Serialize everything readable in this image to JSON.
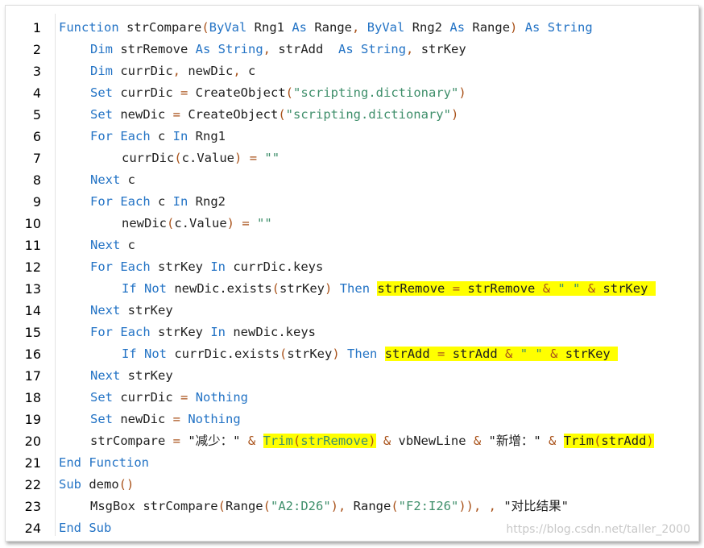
{
  "colors": {
    "keyword": "#2373c5",
    "string": "#3f8f6b",
    "operator": "#a9521a",
    "plain": "#1f1f1f",
    "highlight": "#ffff00"
  },
  "lines": [
    {
      "num": "1",
      "indent": 0,
      "tokens": [
        {
          "t": "Function",
          "c": "kw"
        },
        {
          "t": " strCompare"
        },
        {
          "t": "(",
          "c": "op"
        },
        {
          "t": "ByVal",
          "c": "kw"
        },
        {
          "t": " Rng1 "
        },
        {
          "t": "As",
          "c": "kw"
        },
        {
          "t": " Range"
        },
        {
          "t": ",",
          "c": "op"
        },
        {
          "t": " "
        },
        {
          "t": "ByVal",
          "c": "kw"
        },
        {
          "t": " Rng2 "
        },
        {
          "t": "As",
          "c": "kw"
        },
        {
          "t": " Range"
        },
        {
          "t": ")",
          "c": "op"
        },
        {
          "t": " "
        },
        {
          "t": "As",
          "c": "kw"
        },
        {
          "t": " "
        },
        {
          "t": "String",
          "c": "kw"
        }
      ]
    },
    {
      "num": "2",
      "indent": 1,
      "tokens": [
        {
          "t": "Dim",
          "c": "kw"
        },
        {
          "t": " strRemove "
        },
        {
          "t": "As",
          "c": "kw"
        },
        {
          "t": " "
        },
        {
          "t": "String",
          "c": "kw"
        },
        {
          "t": ",",
          "c": "op"
        },
        {
          "t": " strAdd  "
        },
        {
          "t": "As",
          "c": "kw"
        },
        {
          "t": " "
        },
        {
          "t": "String",
          "c": "kw"
        },
        {
          "t": ",",
          "c": "op"
        },
        {
          "t": " strKey"
        }
      ]
    },
    {
      "num": "3",
      "indent": 1,
      "tokens": [
        {
          "t": "Dim",
          "c": "kw"
        },
        {
          "t": " currDic"
        },
        {
          "t": ",",
          "c": "op"
        },
        {
          "t": " newDic"
        },
        {
          "t": ",",
          "c": "op"
        },
        {
          "t": " c"
        }
      ]
    },
    {
      "num": "4",
      "indent": 1,
      "tokens": [
        {
          "t": "Set",
          "c": "kw"
        },
        {
          "t": " currDic "
        },
        {
          "t": "=",
          "c": "op"
        },
        {
          "t": " CreateObject"
        },
        {
          "t": "(",
          "c": "op"
        },
        {
          "t": "\"scripting.dictionary\"",
          "c": "str"
        },
        {
          "t": ")",
          "c": "op"
        }
      ]
    },
    {
      "num": "5",
      "indent": 1,
      "tokens": [
        {
          "t": "Set",
          "c": "kw"
        },
        {
          "t": " newDic "
        },
        {
          "t": "=",
          "c": "op"
        },
        {
          "t": " CreateObject"
        },
        {
          "t": "(",
          "c": "op"
        },
        {
          "t": "\"scripting.dictionary\"",
          "c": "str"
        },
        {
          "t": ")",
          "c": "op"
        }
      ]
    },
    {
      "num": "6",
      "indent": 1,
      "tokens": [
        {
          "t": "For",
          "c": "kw"
        },
        {
          "t": " "
        },
        {
          "t": "Each",
          "c": "kw"
        },
        {
          "t": " c "
        },
        {
          "t": "In",
          "c": "kw"
        },
        {
          "t": " Rng1"
        }
      ]
    },
    {
      "num": "7",
      "indent": 2,
      "tokens": [
        {
          "t": "currDic"
        },
        {
          "t": "(",
          "c": "op"
        },
        {
          "t": "c.Value"
        },
        {
          "t": ")",
          "c": "op"
        },
        {
          "t": " "
        },
        {
          "t": "=",
          "c": "op"
        },
        {
          "t": " "
        },
        {
          "t": "\"\"",
          "c": "str"
        }
      ]
    },
    {
      "num": "8",
      "indent": 1,
      "tokens": [
        {
          "t": "Next",
          "c": "kw"
        },
        {
          "t": " c"
        }
      ]
    },
    {
      "num": "9",
      "indent": 1,
      "tokens": [
        {
          "t": "For",
          "c": "kw"
        },
        {
          "t": " "
        },
        {
          "t": "Each",
          "c": "kw"
        },
        {
          "t": " c "
        },
        {
          "t": "In",
          "c": "kw"
        },
        {
          "t": " Rng2"
        }
      ]
    },
    {
      "num": "10",
      "indent": 2,
      "tokens": [
        {
          "t": "newDic"
        },
        {
          "t": "(",
          "c": "op"
        },
        {
          "t": "c.Value"
        },
        {
          "t": ")",
          "c": "op"
        },
        {
          "t": " "
        },
        {
          "t": "=",
          "c": "op"
        },
        {
          "t": " "
        },
        {
          "t": "\"\"",
          "c": "str"
        }
      ]
    },
    {
      "num": "11",
      "indent": 1,
      "tokens": [
        {
          "t": "Next",
          "c": "kw"
        },
        {
          "t": " c"
        }
      ]
    },
    {
      "num": "12",
      "indent": 1,
      "tokens": [
        {
          "t": "For",
          "c": "kw"
        },
        {
          "t": " "
        },
        {
          "t": "Each",
          "c": "kw"
        },
        {
          "t": " strKey "
        },
        {
          "t": "In",
          "c": "kw"
        },
        {
          "t": " currDic.keys"
        }
      ]
    },
    {
      "num": "13",
      "indent": 2,
      "tokens": [
        {
          "t": "If",
          "c": "kw"
        },
        {
          "t": " "
        },
        {
          "t": "Not",
          "c": "kw"
        },
        {
          "t": " newDic.exists"
        },
        {
          "t": "(",
          "c": "op"
        },
        {
          "t": "strKey"
        },
        {
          "t": ")",
          "c": "op"
        },
        {
          "t": " "
        },
        {
          "t": "Then",
          "c": "kw"
        },
        {
          "t": " "
        },
        {
          "t": "strRemove ",
          "h": true
        },
        {
          "t": "=",
          "c": "op",
          "h": true
        },
        {
          "t": " strRemove ",
          "h": true
        },
        {
          "t": "&",
          "c": "op",
          "h": true
        },
        {
          "t": " ",
          "h": true
        },
        {
          "t": "\" \"",
          "c": "str",
          "h": true
        },
        {
          "t": " ",
          "h": true
        },
        {
          "t": "&",
          "c": "op",
          "h": true
        },
        {
          "t": " strKey ",
          "h": true
        }
      ]
    },
    {
      "num": "14",
      "indent": 1,
      "tokens": [
        {
          "t": "Next",
          "c": "kw"
        },
        {
          "t": " strKey"
        }
      ]
    },
    {
      "num": "15",
      "indent": 1,
      "tokens": [
        {
          "t": "For",
          "c": "kw"
        },
        {
          "t": " "
        },
        {
          "t": "Each",
          "c": "kw"
        },
        {
          "t": " strKey "
        },
        {
          "t": "In",
          "c": "kw"
        },
        {
          "t": " newDic.keys"
        }
      ]
    },
    {
      "num": "16",
      "indent": 2,
      "tokens": [
        {
          "t": "If",
          "c": "kw"
        },
        {
          "t": " "
        },
        {
          "t": "Not",
          "c": "kw"
        },
        {
          "t": " currDic.exists"
        },
        {
          "t": "(",
          "c": "op"
        },
        {
          "t": "strKey"
        },
        {
          "t": ")",
          "c": "op"
        },
        {
          "t": " "
        },
        {
          "t": "Then",
          "c": "kw"
        },
        {
          "t": " "
        },
        {
          "t": "strAdd ",
          "h": true
        },
        {
          "t": "=",
          "c": "op",
          "h": true
        },
        {
          "t": " strAdd ",
          "h": true
        },
        {
          "t": "&",
          "c": "op",
          "h": true
        },
        {
          "t": " ",
          "h": true
        },
        {
          "t": "\" \"",
          "c": "str",
          "h": true
        },
        {
          "t": " ",
          "h": true
        },
        {
          "t": "&",
          "c": "op",
          "h": true
        },
        {
          "t": " strKey ",
          "h": true
        }
      ]
    },
    {
      "num": "17",
      "indent": 1,
      "tokens": [
        {
          "t": "Next",
          "c": "kw"
        },
        {
          "t": " strKey"
        }
      ]
    },
    {
      "num": "18",
      "indent": 1,
      "tokens": [
        {
          "t": "Set",
          "c": "kw"
        },
        {
          "t": " currDic "
        },
        {
          "t": "=",
          "c": "op"
        },
        {
          "t": " "
        },
        {
          "t": "Nothing",
          "c": "kw"
        }
      ]
    },
    {
      "num": "19",
      "indent": 1,
      "tokens": [
        {
          "t": "Set",
          "c": "kw"
        },
        {
          "t": " newDic "
        },
        {
          "t": "=",
          "c": "op"
        },
        {
          "t": " "
        },
        {
          "t": "Nothing",
          "c": "kw"
        }
      ]
    },
    {
      "num": "20",
      "indent": 1,
      "tokens": [
        {
          "t": "strCompare "
        },
        {
          "t": "=",
          "c": "op"
        },
        {
          "t": " \"减少：\" "
        },
        {
          "t": "&",
          "c": "op"
        },
        {
          "t": " "
        },
        {
          "t": "Trim",
          "c": "str",
          "h": true
        },
        {
          "t": "(",
          "c": "op",
          "h": true
        },
        {
          "t": "strRemove",
          "c": "str",
          "h": true
        },
        {
          "t": ")",
          "c": "op",
          "h": true
        },
        {
          "t": " "
        },
        {
          "t": "&",
          "c": "op"
        },
        {
          "t": " vbNewLine "
        },
        {
          "t": "&",
          "c": "op"
        },
        {
          "t": " \"新增：\" "
        },
        {
          "t": "&",
          "c": "op"
        },
        {
          "t": " "
        },
        {
          "t": "Trim",
          "h": true
        },
        {
          "t": "(",
          "c": "op",
          "h": true
        },
        {
          "t": "strAdd",
          "h": true
        },
        {
          "t": ")",
          "c": "op",
          "h": true
        }
      ]
    },
    {
      "num": "21",
      "indent": 0,
      "tokens": [
        {
          "t": "End",
          "c": "kw"
        },
        {
          "t": " "
        },
        {
          "t": "Function",
          "c": "kw"
        }
      ]
    },
    {
      "num": "22",
      "indent": 0,
      "tokens": [
        {
          "t": "Sub",
          "c": "kw"
        },
        {
          "t": " demo"
        },
        {
          "t": "()",
          "c": "op"
        }
      ]
    },
    {
      "num": "23",
      "indent": 1,
      "tokens": [
        {
          "t": "MsgBox strCompare"
        },
        {
          "t": "(",
          "c": "op"
        },
        {
          "t": "Range"
        },
        {
          "t": "(",
          "c": "op"
        },
        {
          "t": "\"A2:D26\"",
          "c": "str"
        },
        {
          "t": "),",
          "c": "op"
        },
        {
          "t": " Range"
        },
        {
          "t": "(",
          "c": "op"
        },
        {
          "t": "\"F2:I26\"",
          "c": "str"
        },
        {
          "t": ")),",
          "c": "op"
        },
        {
          "t": " "
        },
        {
          "t": ",",
          "c": "op"
        },
        {
          "t": " \"对比结果\""
        }
      ]
    },
    {
      "num": "24",
      "indent": 0,
      "tokens": [
        {
          "t": "End",
          "c": "kw"
        },
        {
          "t": " "
        },
        {
          "t": "Sub",
          "c": "kw"
        }
      ]
    }
  ],
  "watermark": "https://blog.csdn.net/taller_2000"
}
